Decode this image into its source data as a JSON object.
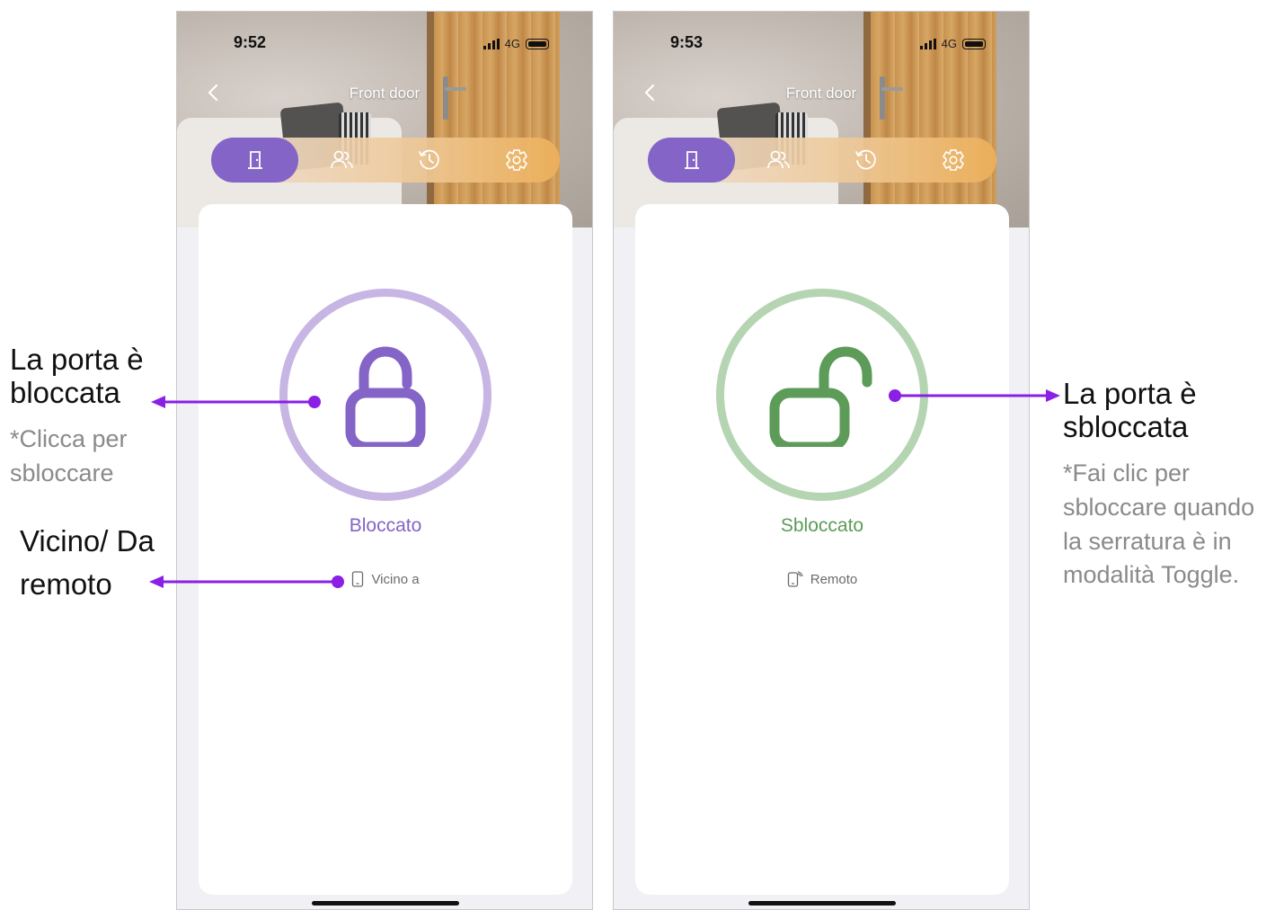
{
  "screens": [
    {
      "time": "9:52",
      "network": "4G",
      "title": "Front door",
      "lock_state": "Bloccato",
      "mode_label": "Vicino a",
      "state_color": "#8464c6",
      "ring_color": "#c7b5e3",
      "tabs": [
        "door-icon",
        "users-icon",
        "history-icon",
        "settings-icon"
      ],
      "active_tab": 0
    },
    {
      "time": "9:53",
      "network": "4G",
      "title": "Front door",
      "lock_state": "Sbloccato",
      "mode_label": "Remoto",
      "state_color": "#5c9b58",
      "ring_color": "#b5d4b1",
      "tabs": [
        "door-icon",
        "users-icon",
        "history-icon",
        "settings-icon"
      ],
      "active_tab": 0
    }
  ],
  "annotations": {
    "locked": {
      "title_line1": "La porta è",
      "title_line2": "bloccata",
      "note_line1": "*Clicca per",
      "note_line2": "sbloccare"
    },
    "proximity": {
      "line1": "Vicino/ Da",
      "line2": "remoto"
    },
    "unlocked": {
      "title_line1": "La porta è",
      "title_line2": "sbloccata",
      "note_lines": [
        "*Fai clic per",
        "sbloccare quando",
        "la serratura è in",
        "modalità Toggle."
      ]
    },
    "arrow_color": "#8a1fe6"
  }
}
